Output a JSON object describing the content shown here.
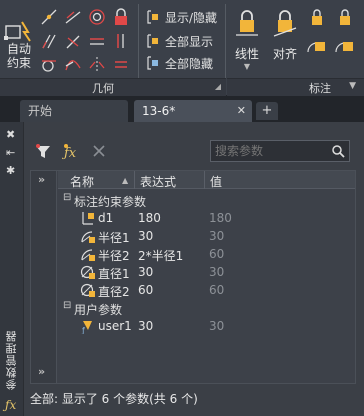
{
  "ribbon": {
    "auto_constrain": {
      "line1": "自动",
      "line2": "约束"
    },
    "show_hide": "显示/隐藏",
    "show_all": "全部显示",
    "hide_all": "全部隐藏",
    "geometric_panel": "几何",
    "linear": "线性",
    "aligned": "对齐",
    "dimension_panel": "标注"
  },
  "tabs": {
    "start": "开始",
    "doc": "13-6*",
    "close": "✕",
    "new": "+"
  },
  "palette": {
    "title": "参数管理器",
    "search_placeholder": "搜索参数",
    "columns": {
      "name": "名称",
      "expression": "表达式",
      "value": "值"
    },
    "groups": [
      {
        "label": "标注约束参数",
        "rows": [
          {
            "name": "d1",
            "expression": "180",
            "value": "180",
            "icon": "linear-dim-icon"
          },
          {
            "name": "半径1",
            "expression": "30",
            "value": "30",
            "icon": "radius-icon"
          },
          {
            "name": "半径2",
            "expression": "2*半径1",
            "value": "60",
            "icon": "radius-icon"
          },
          {
            "name": "直径1",
            "expression": "30",
            "value": "30",
            "icon": "diameter-icon"
          },
          {
            "name": "直径2",
            "expression": "60",
            "value": "60",
            "icon": "diameter-icon"
          }
        ]
      },
      {
        "label": "用户参数",
        "rows": [
          {
            "name": "user1",
            "expression": "30",
            "value": "30",
            "icon": "user-param-icon"
          }
        ]
      }
    ],
    "status": "全部: 显示了 6 个参数(共 6 个)"
  }
}
